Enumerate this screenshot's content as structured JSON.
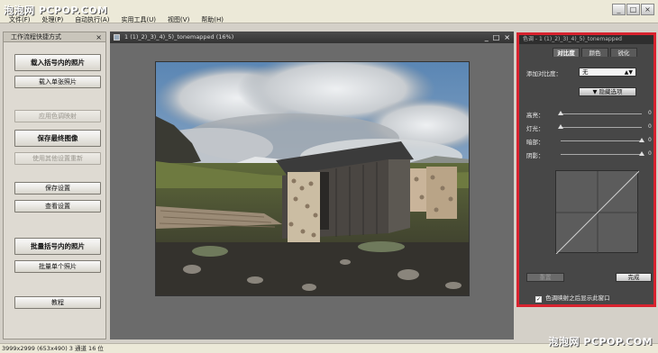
{
  "watermark": {
    "top": "泡泡网 PCPOP.COM",
    "bottom": "泡泡网 PCPOP.COM"
  },
  "menu": [
    "文件(F)",
    "处理(P)",
    "自动执行(A)",
    "实用工具(U)",
    "视图(V)",
    "帮助(H)"
  ],
  "window_controls": {
    "minimize": "_",
    "maximize": "□",
    "close": "×"
  },
  "left_panel": {
    "title": "工作流程快捷方式",
    "close": "×",
    "buttons": [
      {
        "label": "载入括号内的照片"
      },
      {
        "label": "载入单张照片"
      },
      {
        "label": "应用色调映射"
      },
      {
        "label": "保存最终图像"
      },
      {
        "label": "使用其他设置重新"
      },
      {
        "label": "保存设置"
      },
      {
        "label": "查看设置"
      },
      {
        "label": "批量括号内的照片"
      },
      {
        "label": "批量单个照片"
      },
      {
        "label": "教程"
      }
    ]
  },
  "document": {
    "title": "1 (1)_2)_3)_4)_5)_tonemapped (16%)",
    "controls": {
      "minimize": "_",
      "restore": "□",
      "close": "×"
    }
  },
  "right_panel": {
    "title": "色调 - 1 (1)_2)_3)_4)_5)_tonemapped",
    "tabs": [
      "对比度",
      "颜色",
      "锐化"
    ],
    "add_contrast_label": "添加对比度：",
    "add_contrast_value": "无",
    "hide_options": "▼ 隐藏选项",
    "sliders": [
      {
        "label": "高亮：",
        "value": "0"
      },
      {
        "label": "灯光：",
        "value": "0"
      },
      {
        "label": "暗部：",
        "value": "0"
      },
      {
        "label": "阴影：",
        "value": "0"
      }
    ],
    "reset_button": "重置",
    "done_button": "完成",
    "checkbox_label": "色调映射之后显示此窗口",
    "checkbox_checked": true,
    "accent_color": "#d8232f"
  },
  "status": "3999x2999 (653x490) 3 通道 16 位"
}
